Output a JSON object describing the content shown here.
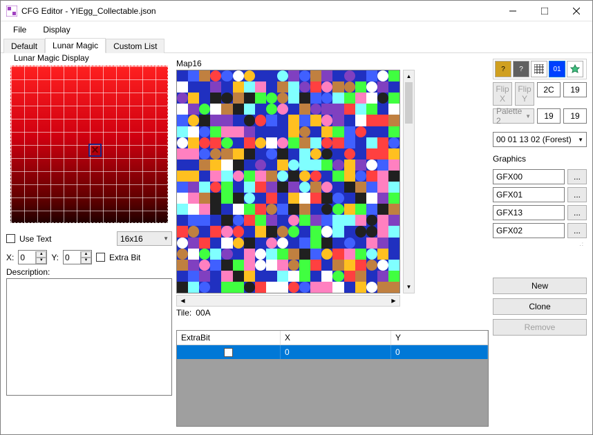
{
  "window": {
    "title": "CFG Editor - YIEgg_Collectable.json"
  },
  "menu": {
    "file": "File",
    "display": "Display"
  },
  "tabs": {
    "default": "Default",
    "lunar_magic": "Lunar Magic",
    "custom_list": "Custom List"
  },
  "lmdisplay_label": "Lunar Magic Display",
  "use_text_label": "Use Text",
  "size_select": "16x16",
  "x_label": "X:",
  "y_label": "Y:",
  "x_value": "0",
  "y_value": "0",
  "extra_bit_label": "Extra Bit",
  "description_label": "Description:",
  "description_value": "",
  "map16_label": "Map16",
  "tile_label": "Tile:",
  "tile_value": "00A",
  "toolbar": {
    "flip_x": "Flip X",
    "flip_y": "Flip Y",
    "v1": "2C",
    "v2": "19",
    "palette": "Palette 2",
    "v3": "19",
    "v4": "19",
    "tileset": "00 01 13 02 (Forest)"
  },
  "graphics_label": "Graphics",
  "gfx": [
    "GFX00",
    "GFX01",
    "GFX13",
    "GFX02"
  ],
  "table": {
    "col0": "ExtraBit",
    "col1": "X",
    "col2": "Y",
    "row0_x": "0",
    "row0_y": "0"
  },
  "buttons": {
    "new": "New",
    "clone": "Clone",
    "remove": "Remove"
  },
  "toolbtn_labels": {
    "t4": "01"
  },
  "browse_label": "..."
}
